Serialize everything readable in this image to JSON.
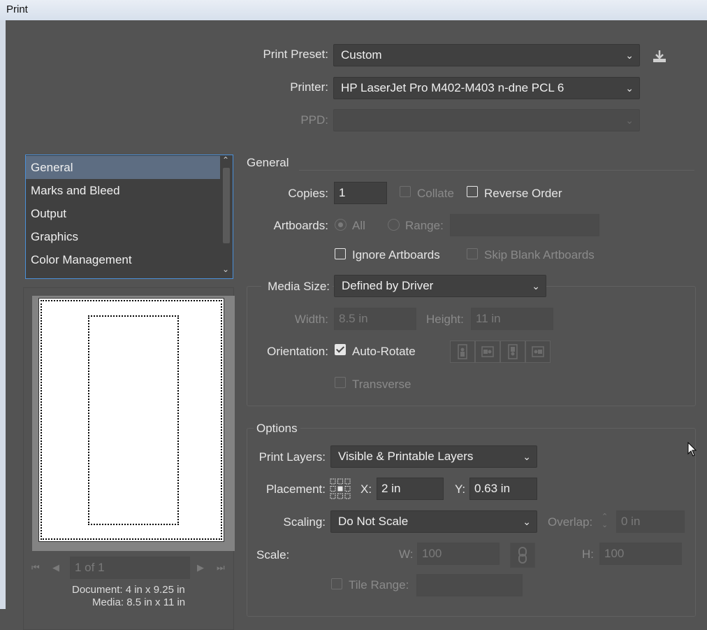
{
  "window": {
    "title": "Print"
  },
  "top": {
    "preset_label": "Print Preset:",
    "preset_value": "Custom",
    "printer_label": "Printer:",
    "printer_value": "HP LaserJet Pro M402-M403 n-dne PCL 6",
    "ppd_label": "PPD:",
    "ppd_value": ""
  },
  "sidebar": {
    "items": [
      {
        "label": "General",
        "selected": true
      },
      {
        "label": "Marks and Bleed"
      },
      {
        "label": "Output"
      },
      {
        "label": "Graphics"
      },
      {
        "label": "Color Management"
      }
    ]
  },
  "preview": {
    "page_value": "1 of 1",
    "doc_info": "Document: 4 in x 9.25 in",
    "media_info": "Media: 8.5 in x 11 in"
  },
  "general": {
    "section_title": "General",
    "copies_label": "Copies:",
    "copies_value": "1",
    "collate_label": "Collate",
    "reverse_label": "Reverse Order",
    "artboards_label": "Artboards:",
    "all_label": "All",
    "range_label": "Range:",
    "ignore_label": "Ignore Artboards",
    "skip_label": "Skip Blank Artboards",
    "media_size_label": "Media Size:",
    "media_size_value": "Defined by Driver",
    "width_label": "Width:",
    "width_value": "8.5 in",
    "height_label": "Height:",
    "height_value": "11 in",
    "orientation_label": "Orientation:",
    "autorotate_label": "Auto-Rotate",
    "transverse_label": "Transverse"
  },
  "options": {
    "section_title": "Options",
    "layers_label": "Print Layers:",
    "layers_value": "Visible & Printable Layers",
    "placement_label": "Placement:",
    "x_label": "X:",
    "x_value": "2 in",
    "y_label": "Y:",
    "y_value": "0.63 in",
    "scaling_label": "Scaling:",
    "scaling_value": "Do Not Scale",
    "overlap_label": "Overlap:",
    "overlap_value": "0 in",
    "scale_label": "Scale:",
    "w_label": "W:",
    "w_value": "100",
    "h_label": "H:",
    "h_value": "100",
    "tile_label": "Tile Range:"
  },
  "icons": [
    "save-preset-icon",
    "chevron-down-icon",
    "first-page-icon",
    "prev-page-icon",
    "next-page-icon",
    "last-page-icon",
    "orientation-portrait-icon",
    "orientation-landscape-icon",
    "orientation-portrait-flipped-icon",
    "orientation-landscape-flipped-icon",
    "placement-grid-icon",
    "link-icon",
    "mouse-cursor-icon"
  ]
}
